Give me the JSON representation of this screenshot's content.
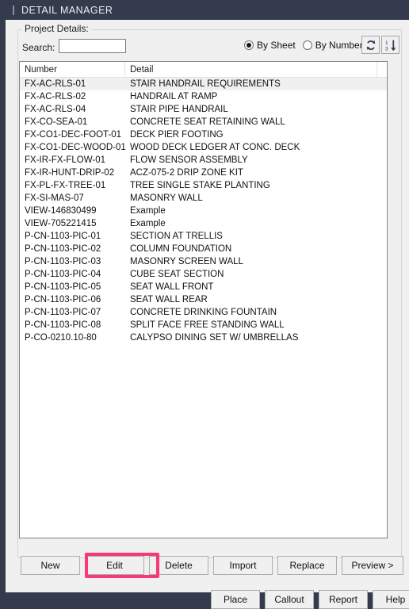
{
  "window": {
    "title": "DETAIL MANAGER",
    "accent_highlight": "#f73a73",
    "titlebar_bg": "#333b4d",
    "client_bg": "#f0f0f0"
  },
  "group": {
    "legend": "Project Details:"
  },
  "search": {
    "label": "Search:",
    "value": "",
    "placeholder": ""
  },
  "view_mode": {
    "options": [
      {
        "label": "By Sheet",
        "selected": true
      },
      {
        "label": "By Number",
        "selected": false
      }
    ]
  },
  "toolbar": {
    "refresh_icon": "refresh-icon",
    "sort_icon": "sort-numeric-descending-icon"
  },
  "list": {
    "columns": [
      "Number",
      "Detail"
    ],
    "selected_index": 0,
    "rows": [
      {
        "number": "FX-AC-RLS-01",
        "detail": "STAIR HANDRAIL REQUIREMENTS"
      },
      {
        "number": "FX-AC-RLS-02",
        "detail": "HANDRAIL AT RAMP"
      },
      {
        "number": "FX-AC-RLS-04",
        "detail": "STAIR PIPE HANDRAIL"
      },
      {
        "number": "FX-CO-SEA-01",
        "detail": "CONCRETE SEAT RETAINING WALL"
      },
      {
        "number": "FX-CO1-DEC-FOOT-01",
        "detail": "DECK PIER FOOTING"
      },
      {
        "number": "FX-CO1-DEC-WOOD-01",
        "detail": "WOOD DECK LEDGER AT CONC. DECK"
      },
      {
        "number": "FX-IR-FX-FLOW-01",
        "detail": "FLOW SENSOR ASSEMBLY"
      },
      {
        "number": "FX-IR-HUNT-DRIP-02",
        "detail": "ACZ-075-2 DRIP ZONE KIT"
      },
      {
        "number": "FX-PL-FX-TREE-01",
        "detail": "TREE SINGLE STAKE PLANTING"
      },
      {
        "number": "FX-SI-MAS-07",
        "detail": "MASONRY WALL"
      },
      {
        "number": "VIEW-146830499",
        "detail": "Example"
      },
      {
        "number": "VIEW-705221415",
        "detail": "Example"
      },
      {
        "number": "P-CN-1103-PIC-01",
        "detail": "SECTION AT TRELLIS"
      },
      {
        "number": "P-CN-1103-PIC-02",
        "detail": "COLUMN FOUNDATION"
      },
      {
        "number": "P-CN-1103-PIC-03",
        "detail": "MASONRY SCREEN WALL"
      },
      {
        "number": "P-CN-1103-PIC-04",
        "detail": "CUBE SEAT SECTION"
      },
      {
        "number": "P-CN-1103-PIC-05",
        "detail": "SEAT WALL FRONT"
      },
      {
        "number": "P-CN-1103-PIC-06",
        "detail": "SEAT WALL REAR"
      },
      {
        "number": "P-CN-1103-PIC-07",
        "detail": "CONCRETE DRINKING FOUNTAIN"
      },
      {
        "number": "P-CN-1103-PIC-08",
        "detail": "SPLIT FACE FREE STANDING WALL"
      },
      {
        "number": "P-CO-0210.10-80",
        "detail": "CALYPSO DINING SET W/ UMBRELLAS"
      }
    ]
  },
  "actions_primary": {
    "new": "New",
    "edit": "Edit",
    "delete": "Delete",
    "import": "Import",
    "replace": "Replace",
    "preview": "Preview >"
  },
  "actions_secondary": {
    "place": "Place",
    "callout": "Callout",
    "report": "Report",
    "help": "Help"
  }
}
